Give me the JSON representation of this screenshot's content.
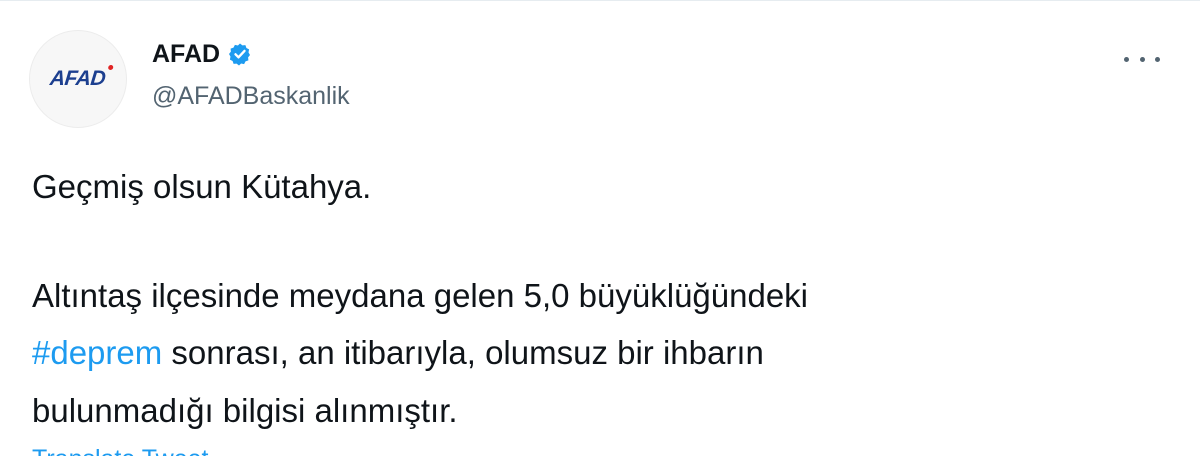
{
  "avatar": {
    "logo_text": "AFAD"
  },
  "author": {
    "display_name": "AFAD",
    "handle": "@AFADBaskanlik",
    "verified_icon": "verified-badge-icon"
  },
  "menu": {
    "icon": "more-options-icon"
  },
  "tweet": {
    "line1": "Geçmiş olsun Kütahya.",
    "line2": "Altıntaş ilçesinde meydana gelen 5,0 büyüklüğündeki",
    "hashtag": "#deprem",
    "line3_rest": " sonrası, an itibarıyla, olumsuz bir ihbarın",
    "line4": "bulunmadığı bilgisi alınmıştır.",
    "translate_label": "Translate Tweet"
  },
  "colors": {
    "link": "#1d9bf0",
    "text": "#0f1419",
    "secondary": "#536471",
    "brand_blue": "#1c3f8f",
    "brand_red": "#e02424"
  }
}
